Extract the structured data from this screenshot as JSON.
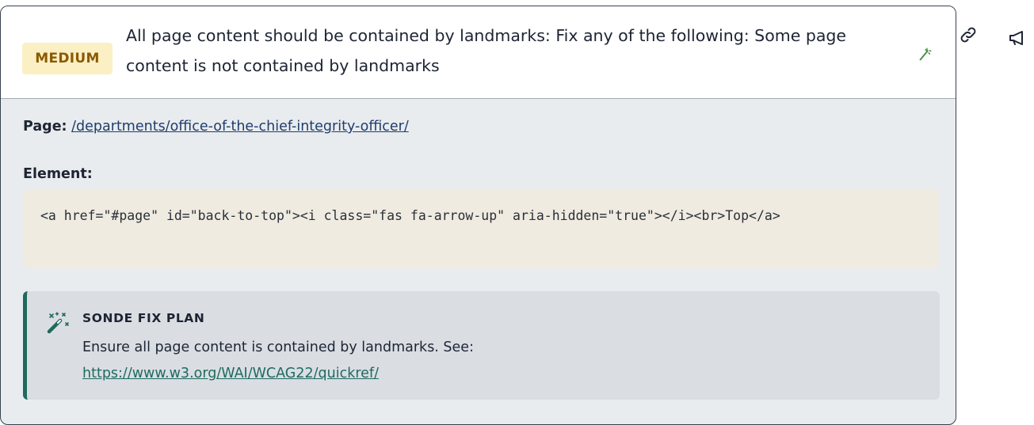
{
  "issue": {
    "severity": "MEDIUM",
    "title": "All page content should be contained by landmarks: Fix any of the following: Some page content is not contained by landmarks"
  },
  "details": {
    "page_label": "Page:",
    "page_link": "/departments/office-of-the-chief-integrity-officer/",
    "element_label": "Element:",
    "element_code": "<a href=\"#page\" id=\"back-to-top\"><i class=\"fas fa-arrow-up\" aria-hidden=\"true\"></i><br>Top</a>"
  },
  "fix_plan": {
    "heading": "SONDE FIX PLAN",
    "text": "Ensure all page content is contained by landmarks. See:",
    "link": "https://www.w3.org/WAI/WCAG22/quickref/"
  },
  "icons": {
    "header_action": "wand-icon",
    "fix_plan": "magic-wand-icon",
    "side_actions": [
      "link-icon",
      "megaphone-icon"
    ]
  },
  "colors": {
    "badge_bg": "#fbefc4",
    "badge_text": "#8a5a00",
    "accent": "#1f6a5e",
    "card_border": "#36404f"
  }
}
